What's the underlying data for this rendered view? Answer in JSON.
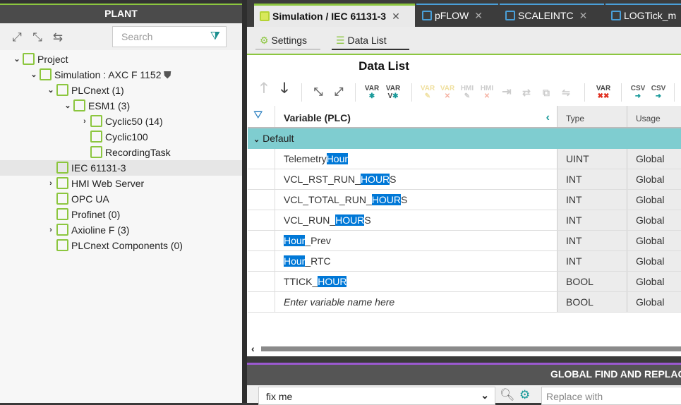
{
  "plant": {
    "title": "PLANT",
    "search_placeholder": "Search",
    "tree": [
      {
        "label": "Project",
        "depth": 0,
        "chev": "down",
        "icon": "folder-icon",
        "color": "#8cc63f"
      },
      {
        "label": "Simulation : AXC F 1152",
        "depth": 1,
        "chev": "down",
        "icon": "controller-icon",
        "color": "#8cc63f"
      },
      {
        "label": "PLCnext (1)",
        "depth": 2,
        "chev": "down",
        "icon": "plcnext-icon",
        "color": "#8cc63f"
      },
      {
        "label": "ESM1 (3)",
        "depth": 3,
        "chev": "down",
        "icon": "esm-icon",
        "color": "#8cc63f"
      },
      {
        "label": "Cyclic50 (14)",
        "depth": 4,
        "chev": "right",
        "icon": "cyclic-task-icon",
        "color": "#8cc63f"
      },
      {
        "label": "Cyclic100",
        "depth": 4,
        "chev": "",
        "icon": "cyclic-task-icon",
        "color": "#8cc63f"
      },
      {
        "label": "RecordingTask",
        "depth": 4,
        "chev": "",
        "icon": "cyclic-task-icon",
        "color": "#8cc63f"
      },
      {
        "label": "IEC 61131-3",
        "depth": 2,
        "chev": "",
        "icon": "chip-icon",
        "color": "#8cc63f",
        "selected": true
      },
      {
        "label": "HMI Web Server",
        "depth": 2,
        "chev": "right",
        "icon": "globe-icon",
        "color": "#8cc63f"
      },
      {
        "label": "OPC UA",
        "depth": 2,
        "chev": "",
        "icon": "network-icon",
        "color": "#8cc63f"
      },
      {
        "label": "Profinet (0)",
        "depth": 2,
        "chev": "",
        "icon": "profinet-icon",
        "color": "#8cc63f"
      },
      {
        "label": "Axioline F (3)",
        "depth": 2,
        "chev": "right",
        "icon": "axioline-icon",
        "color": "#8cc63f"
      },
      {
        "label": "PLCnext Components (0)",
        "depth": 2,
        "chev": "",
        "icon": "components-icon",
        "color": "#8cc63f"
      }
    ]
  },
  "tabs": [
    {
      "label": "Simulation / IEC 61131-3",
      "active": true
    },
    {
      "label": "pFLOW"
    },
    {
      "label": "SCALEINTC"
    },
    {
      "label": "LOGTick_m"
    }
  ],
  "subtabs": {
    "settings": "Settings",
    "data_list": "Data List"
  },
  "datalist": {
    "title": "Data List",
    "columns": {
      "variable": "Variable (PLC)",
      "type": "Type",
      "usage": "Usage"
    },
    "group": "Default",
    "rows": [
      {
        "pre": "Telemetry",
        "hl": "Hour",
        "post": "",
        "type": "UINT",
        "usage": "Global"
      },
      {
        "pre": "VCL_RST_RUN_",
        "hl": "HOUR",
        "post": "S",
        "type": "INT",
        "usage": "Global"
      },
      {
        "pre": "VCL_TOTAL_RUN_",
        "hl": "HOUR",
        "post": "S",
        "type": "INT",
        "usage": "Global"
      },
      {
        "pre": "VCL_RUN_",
        "hl": "HOUR",
        "post": "S",
        "type": "INT",
        "usage": "Global"
      },
      {
        "pre": "",
        "hl": "Hour",
        "post": "_Prev",
        "type": "INT",
        "usage": "Global"
      },
      {
        "pre": "",
        "hl": "Hour",
        "post": "_RTC",
        "type": "INT",
        "usage": "Global"
      },
      {
        "pre": "TTICK_",
        "hl": "HOUR",
        "post": "",
        "type": "BOOL",
        "usage": "Global"
      }
    ],
    "new_row": {
      "placeholder": "Enter variable name here",
      "type": "BOOL",
      "usage": "Global"
    }
  },
  "find": {
    "title": "GLOBAL FIND AND REPLACE",
    "search_value": "fix me",
    "replace_placeholder": "Replace with"
  },
  "colors": {
    "accent_green": "#8cc63f",
    "group_teal": "#7fcdd0",
    "highlight": "#0078d7",
    "find_purple": "#9b59d0"
  }
}
